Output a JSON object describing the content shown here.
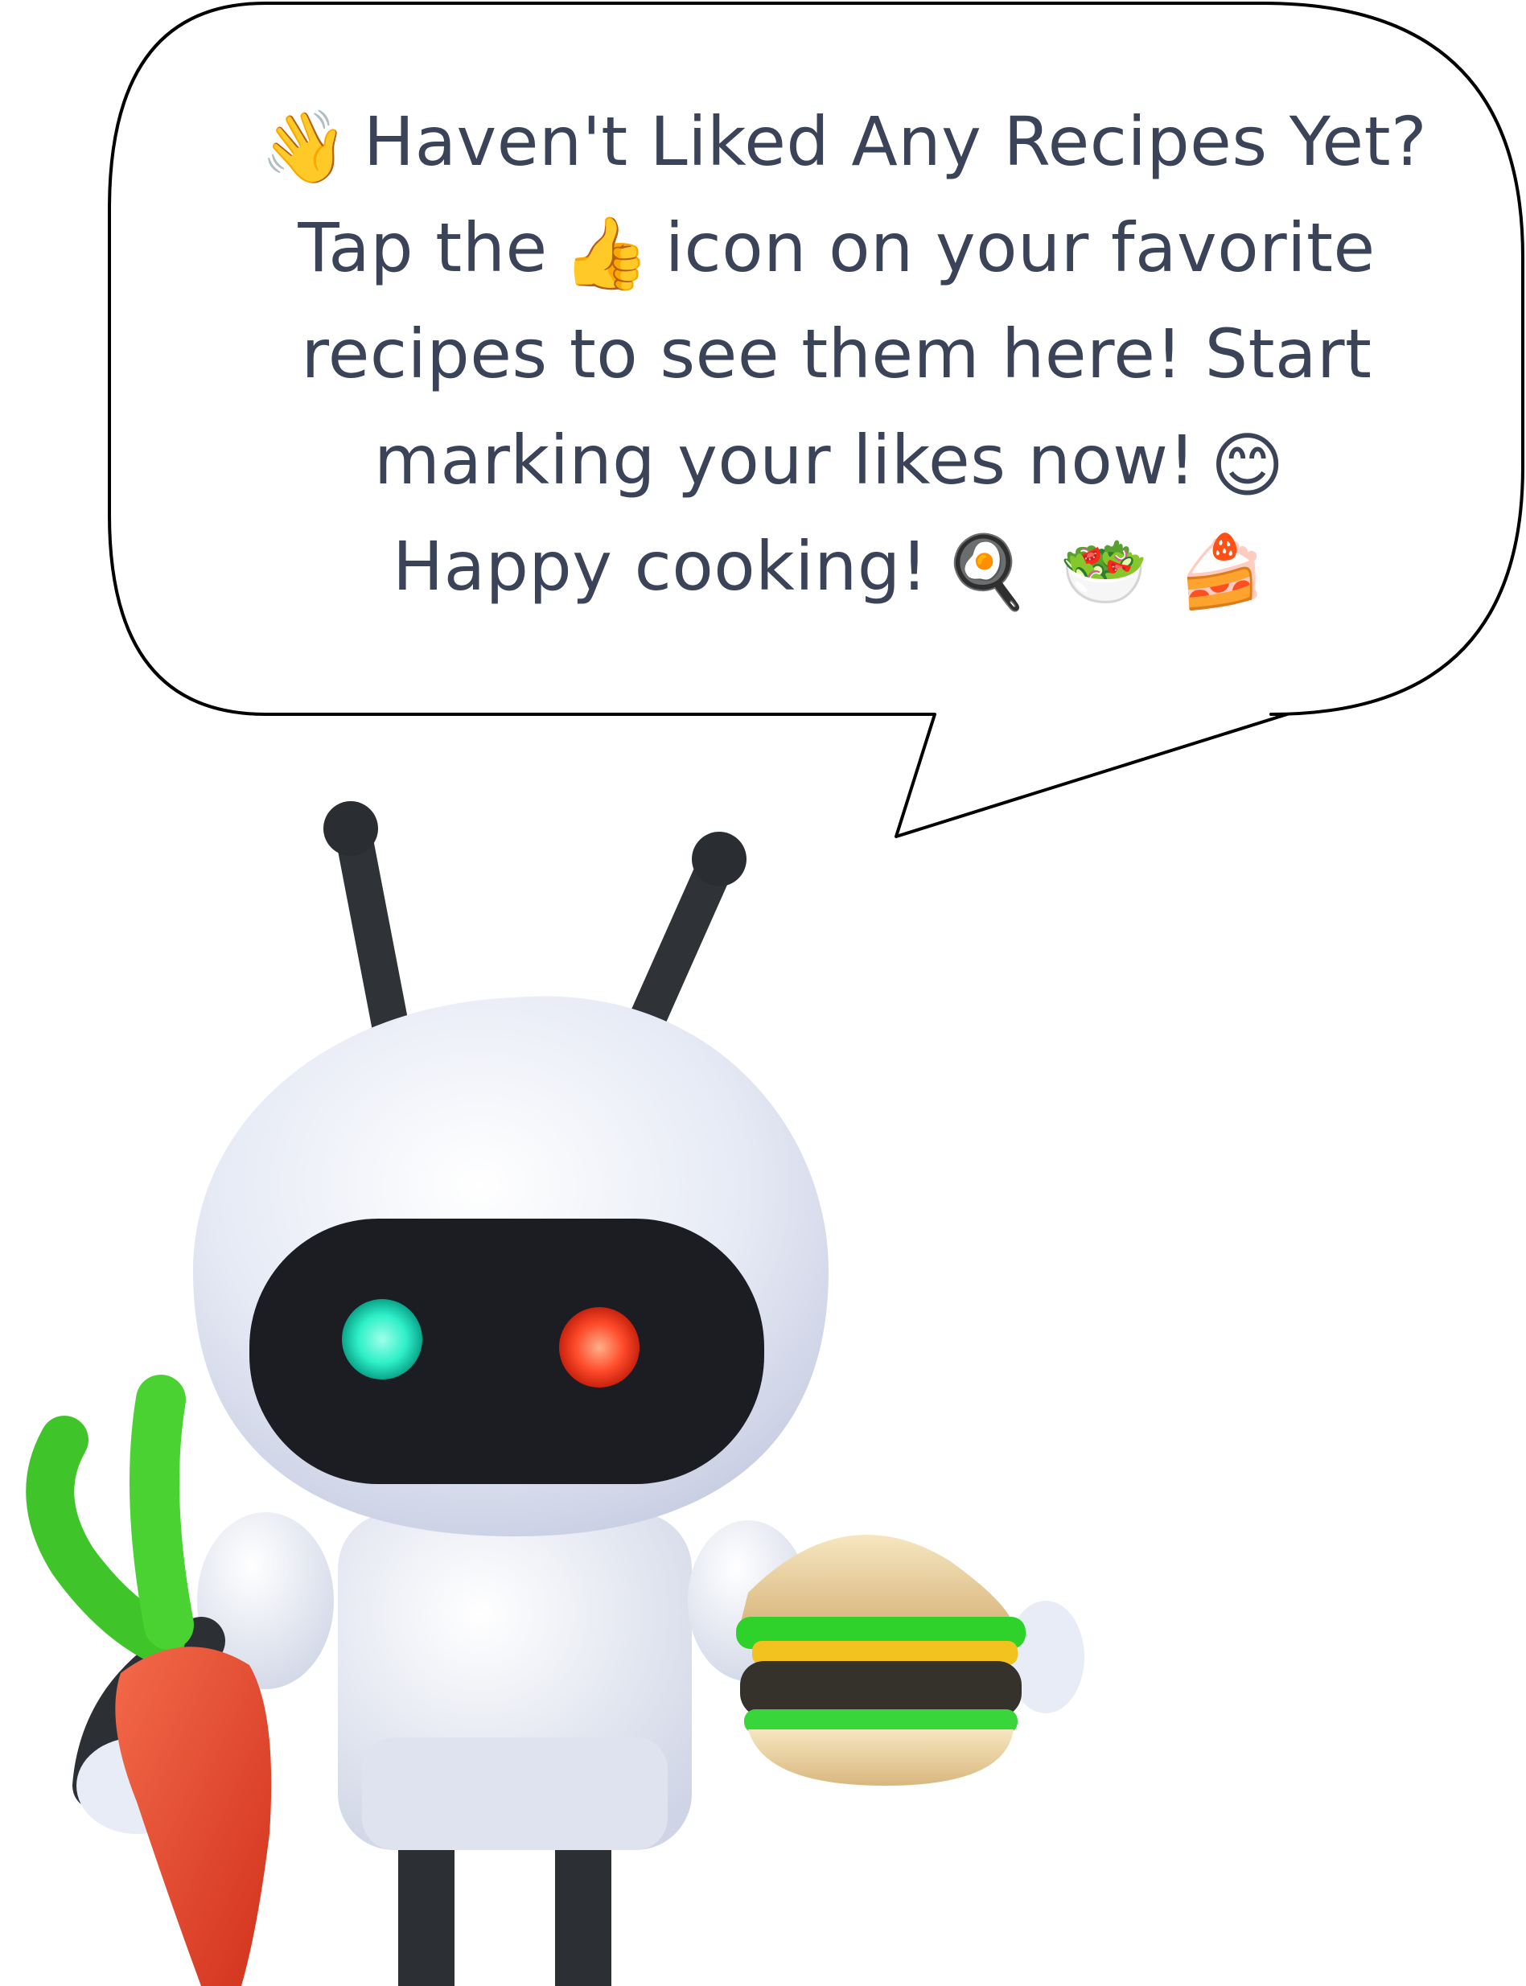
{
  "message": {
    "line1": {
      "emoji": "👋",
      "text": "Haven't Liked Any Recipes Yet?"
    },
    "line2": {
      "before": "Tap the",
      "emoji": "👍",
      "after": "icon on your favorite"
    },
    "line3": {
      "text": "recipes to see them here! Start"
    },
    "line4": {
      "text": "marking your likes now!",
      "emoji": "😊"
    },
    "line5": {
      "text": "Happy cooking!",
      "emoji1": "🍳",
      "emoji2": "🥗",
      "emoji3": "🍰"
    }
  },
  "icons": {
    "wave": "waving-hand-icon",
    "thumbs_up": "thumbs-up-icon",
    "smile": "smiling-face-icon",
    "pan": "frying-pan-egg-icon",
    "salad": "salad-bowl-icon",
    "cake": "cake-slice-icon"
  },
  "colors": {
    "text": "#3a4358",
    "bubble_stroke": "#000000",
    "robot_body": "#e8ecf6",
    "visor": "#1b1d22",
    "eye_left": "#2ef0c8",
    "eye_right": "#ff4a2a",
    "carrot": "#e8452a",
    "carrot_greens": "#43c92b"
  }
}
